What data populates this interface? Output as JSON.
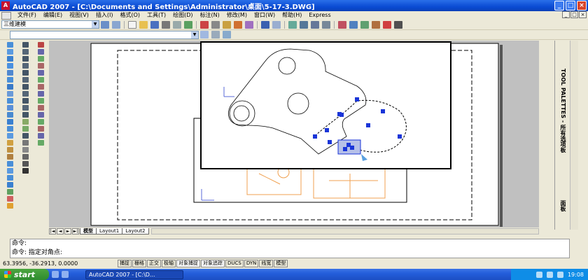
{
  "window": {
    "title": "AutoCAD 2007 - [C:\\Documents and Settings\\Administrator\\桌面\\5-17-3.DWG]",
    "min_glyph": "_",
    "max_glyph": "□",
    "close_glyph": "×"
  },
  "menu": {
    "items": [
      "文件(F)",
      "编辑(E)",
      "视图(V)",
      "插入(I)",
      "格式(O)",
      "工具(T)",
      "绘图(D)",
      "标注(N)",
      "修改(M)",
      "窗口(W)",
      "帮助(H)",
      "Express"
    ]
  },
  "toolbar": {
    "workspace": "三维建模",
    "layer_combo": "",
    "combo_arrow": "▼"
  },
  "palette": {
    "title": "TOOL PALETTES - 所有选项板",
    "label_bottom": "面板"
  },
  "tabs": {
    "nav": [
      "|◄",
      "◄",
      "►",
      "►|"
    ],
    "items": [
      "模型",
      "Layout1",
      "Layout2"
    ]
  },
  "command": {
    "line1": "命令:",
    "line2": "命令: 指定对角点:"
  },
  "status": {
    "coords": "63.3956, -36.2913, 0.0000",
    "buttons": [
      "捕捉",
      "栅格",
      "正交",
      "极轴",
      "对象捕捉",
      "对象追踪",
      "DUCS",
      "DYN",
      "线宽",
      "模型"
    ]
  },
  "taskbar": {
    "start": "start",
    "task": "AutoCAD 2007 - [C:\\D...",
    "clock": "19:08"
  },
  "colors": {
    "drawing_line": "#000000",
    "ghost_part": "#f0a050",
    "grip": "#1a35d8",
    "selection_box": "#000000"
  }
}
